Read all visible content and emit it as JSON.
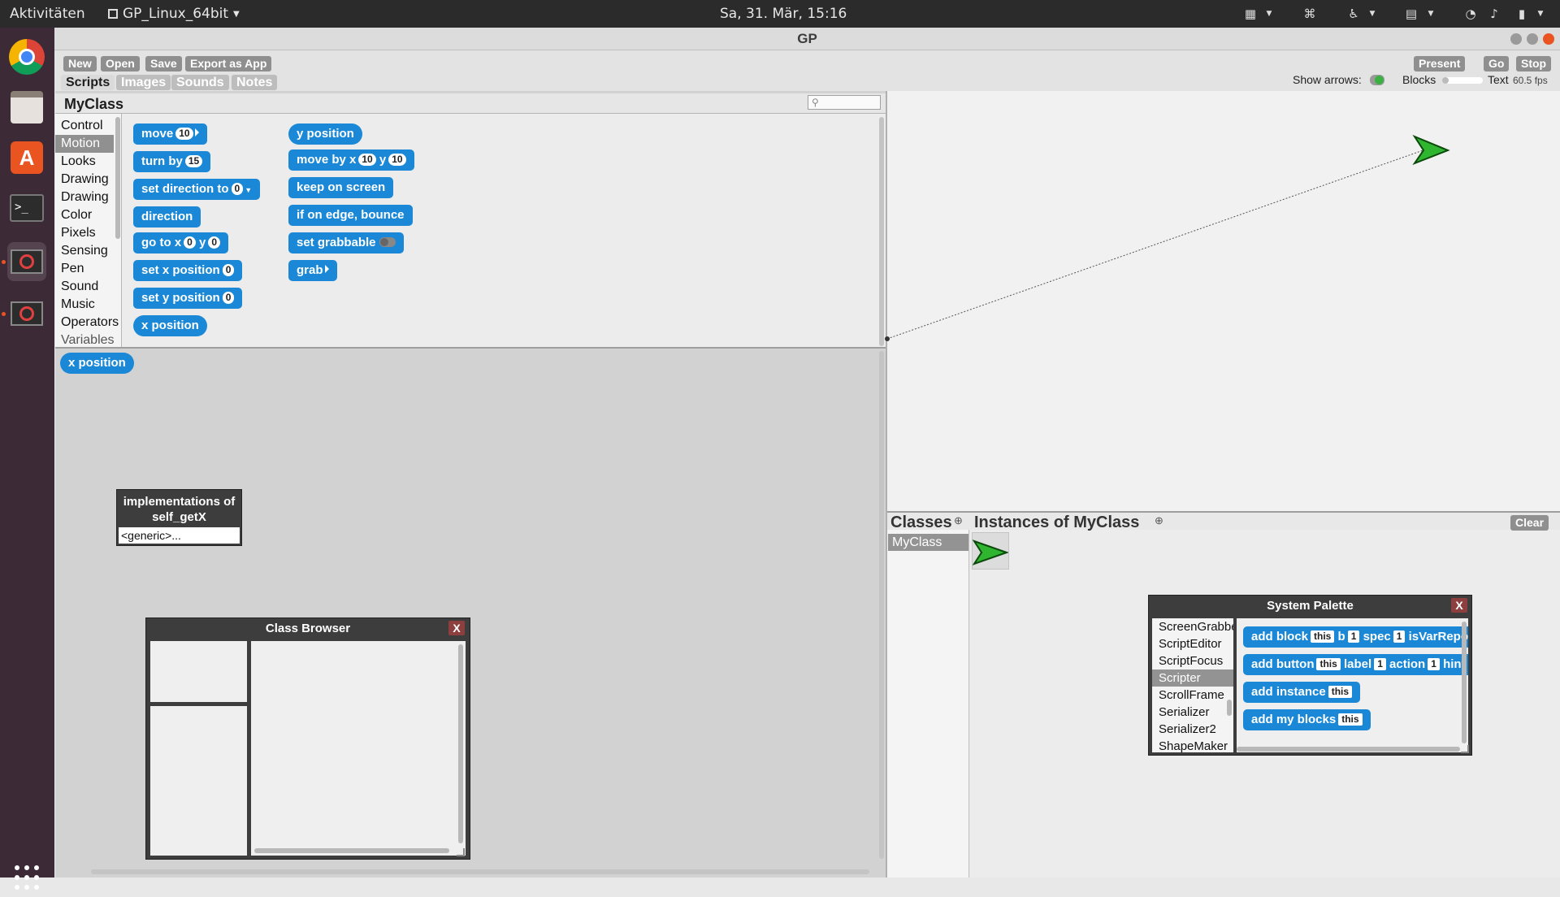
{
  "topbar": {
    "activities": "Aktivitäten",
    "app_name": "GP_Linux_64bit",
    "datetime": "Sa, 31. Mär, 15:16"
  },
  "window": {
    "title": "GP"
  },
  "toolbar": {
    "new": "New",
    "open": "Open",
    "save": "Save",
    "export": "Export as App",
    "present": "Present",
    "go": "Go",
    "stop": "Stop",
    "show_arrows": "Show arrows:",
    "blocks": "Blocks",
    "text": "Text",
    "fps": "60.5 fps"
  },
  "tabs": [
    "Scripts",
    "Images",
    "Sounds",
    "Notes"
  ],
  "class_name": "MyClass",
  "categories": [
    "Control",
    "Motion",
    "Looks",
    "Drawing",
    "Drawing",
    "Color",
    "Pixels",
    "Sensing",
    "Pen",
    "Sound",
    "Music",
    "Operators",
    "Variables"
  ],
  "selected_category": "Motion",
  "blocks": {
    "move": "move",
    "move_val": "10",
    "turn_by": "turn by",
    "turn_val": "15",
    "set_direction": "set direction to",
    "dir_val": "0",
    "direction": "direction",
    "go_to_x": "go to x",
    "go_x": "0",
    "go_y_label": "y",
    "go_y": "0",
    "set_x": "set x position",
    "set_x_val": "0",
    "set_y": "set y position",
    "set_y_val": "0",
    "x_position": "x position",
    "y_position": "y position",
    "move_by_x": "move by x",
    "mbx": "10",
    "mby_label": "y",
    "mby": "10",
    "keep_on_screen": "keep on screen",
    "if_on_edge": "if on edge, bounce",
    "set_grabbable": "set grabbable",
    "grab": "grab"
  },
  "script_block": "x position",
  "implementations": {
    "title": "implementations of self_getX",
    "item": "<generic>..."
  },
  "class_browser": {
    "title": "Class Browser",
    "close": "X"
  },
  "classes": {
    "title": "Classes",
    "items": [
      "MyClass"
    ]
  },
  "instances": {
    "title": "Instances of MyClass",
    "clear": "Clear"
  },
  "system_palette": {
    "title": "System Palette",
    "close": "X",
    "classes": [
      "ScreenGrabber",
      "ScriptEditor",
      "ScriptFocus",
      "Scripter",
      "ScrollFrame",
      "Serializer",
      "Serializer2",
      "ShapeMaker"
    ],
    "selected": "Scripter",
    "b1": "add block",
    "b1_this": "this",
    "b1_b": "b",
    "b1_b_val": "1",
    "b1_spec": "spec",
    "b1_spec_val": "1",
    "b1_tail": "isVarReporter",
    "b2": "add button",
    "b2_this": "this",
    "b2_label": "label",
    "b2_label_val": "1",
    "b2_action": "action",
    "b2_action_val": "1",
    "b2_tail": "hint",
    "b3": "add instance",
    "b3_this": "this",
    "b4": "add my blocks",
    "b4_this": "this"
  },
  "colors": {
    "block_blue": "#1a88d6",
    "dock": "#3c2a36",
    "topbar": "#2b2b2b",
    "sprite_green": "#2fb52f"
  }
}
